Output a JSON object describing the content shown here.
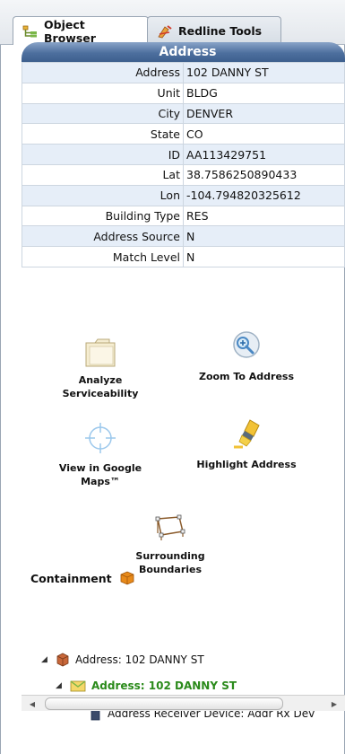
{
  "tabs": [
    {
      "label": "Object Browser",
      "icon": "object-browser-icon",
      "active": true
    },
    {
      "label": "Redline Tools",
      "icon": "redline-tools-icon",
      "active": false
    }
  ],
  "address_table": {
    "title": "Address",
    "rows": [
      {
        "label": "Address",
        "value": "102 DANNY ST"
      },
      {
        "label": "Unit",
        "value": "BLDG"
      },
      {
        "label": "City",
        "value": "DENVER"
      },
      {
        "label": "State",
        "value": "CO"
      },
      {
        "label": "ID",
        "value": "AA113429751"
      },
      {
        "label": "Lat",
        "value": "38.7586250890433"
      },
      {
        "label": "Lon",
        "value": "-104.794820325612"
      },
      {
        "label": "Building Type",
        "value": "RES"
      },
      {
        "label": "Address Source",
        "value": "N"
      },
      {
        "label": "Match Level",
        "value": "N"
      }
    ]
  },
  "actions": {
    "analyze": {
      "line1": "Analyze",
      "line2": "Serviceability",
      "icon": "folder-icon"
    },
    "zoom": {
      "line1": "Zoom To Address",
      "icon": "zoom-icon"
    },
    "google": {
      "line1": "View in Google",
      "line2": "Maps™",
      "icon": "crosshair-icon"
    },
    "highlight": {
      "line1": "Highlight Address",
      "icon": "highlighter-icon"
    },
    "boundaries": {
      "line1": "Surrounding",
      "line2": "Boundaries",
      "icon": "boundary-icon"
    }
  },
  "containment": {
    "title": "Containment",
    "items": [
      {
        "label": "Address: 102 DANNY ST",
        "icon": "box-icon"
      },
      {
        "label": "Address: 102 DANNY ST",
        "icon": "envelope-icon",
        "highlight": true
      },
      {
        "label": "Address Receiver Device: Addr Rx Dev",
        "icon": "device-icon"
      }
    ]
  },
  "colors": {
    "header_blue": "#4d6f9e",
    "row_alt": "#e6eef8",
    "tree_green": "#2a8a1a"
  }
}
